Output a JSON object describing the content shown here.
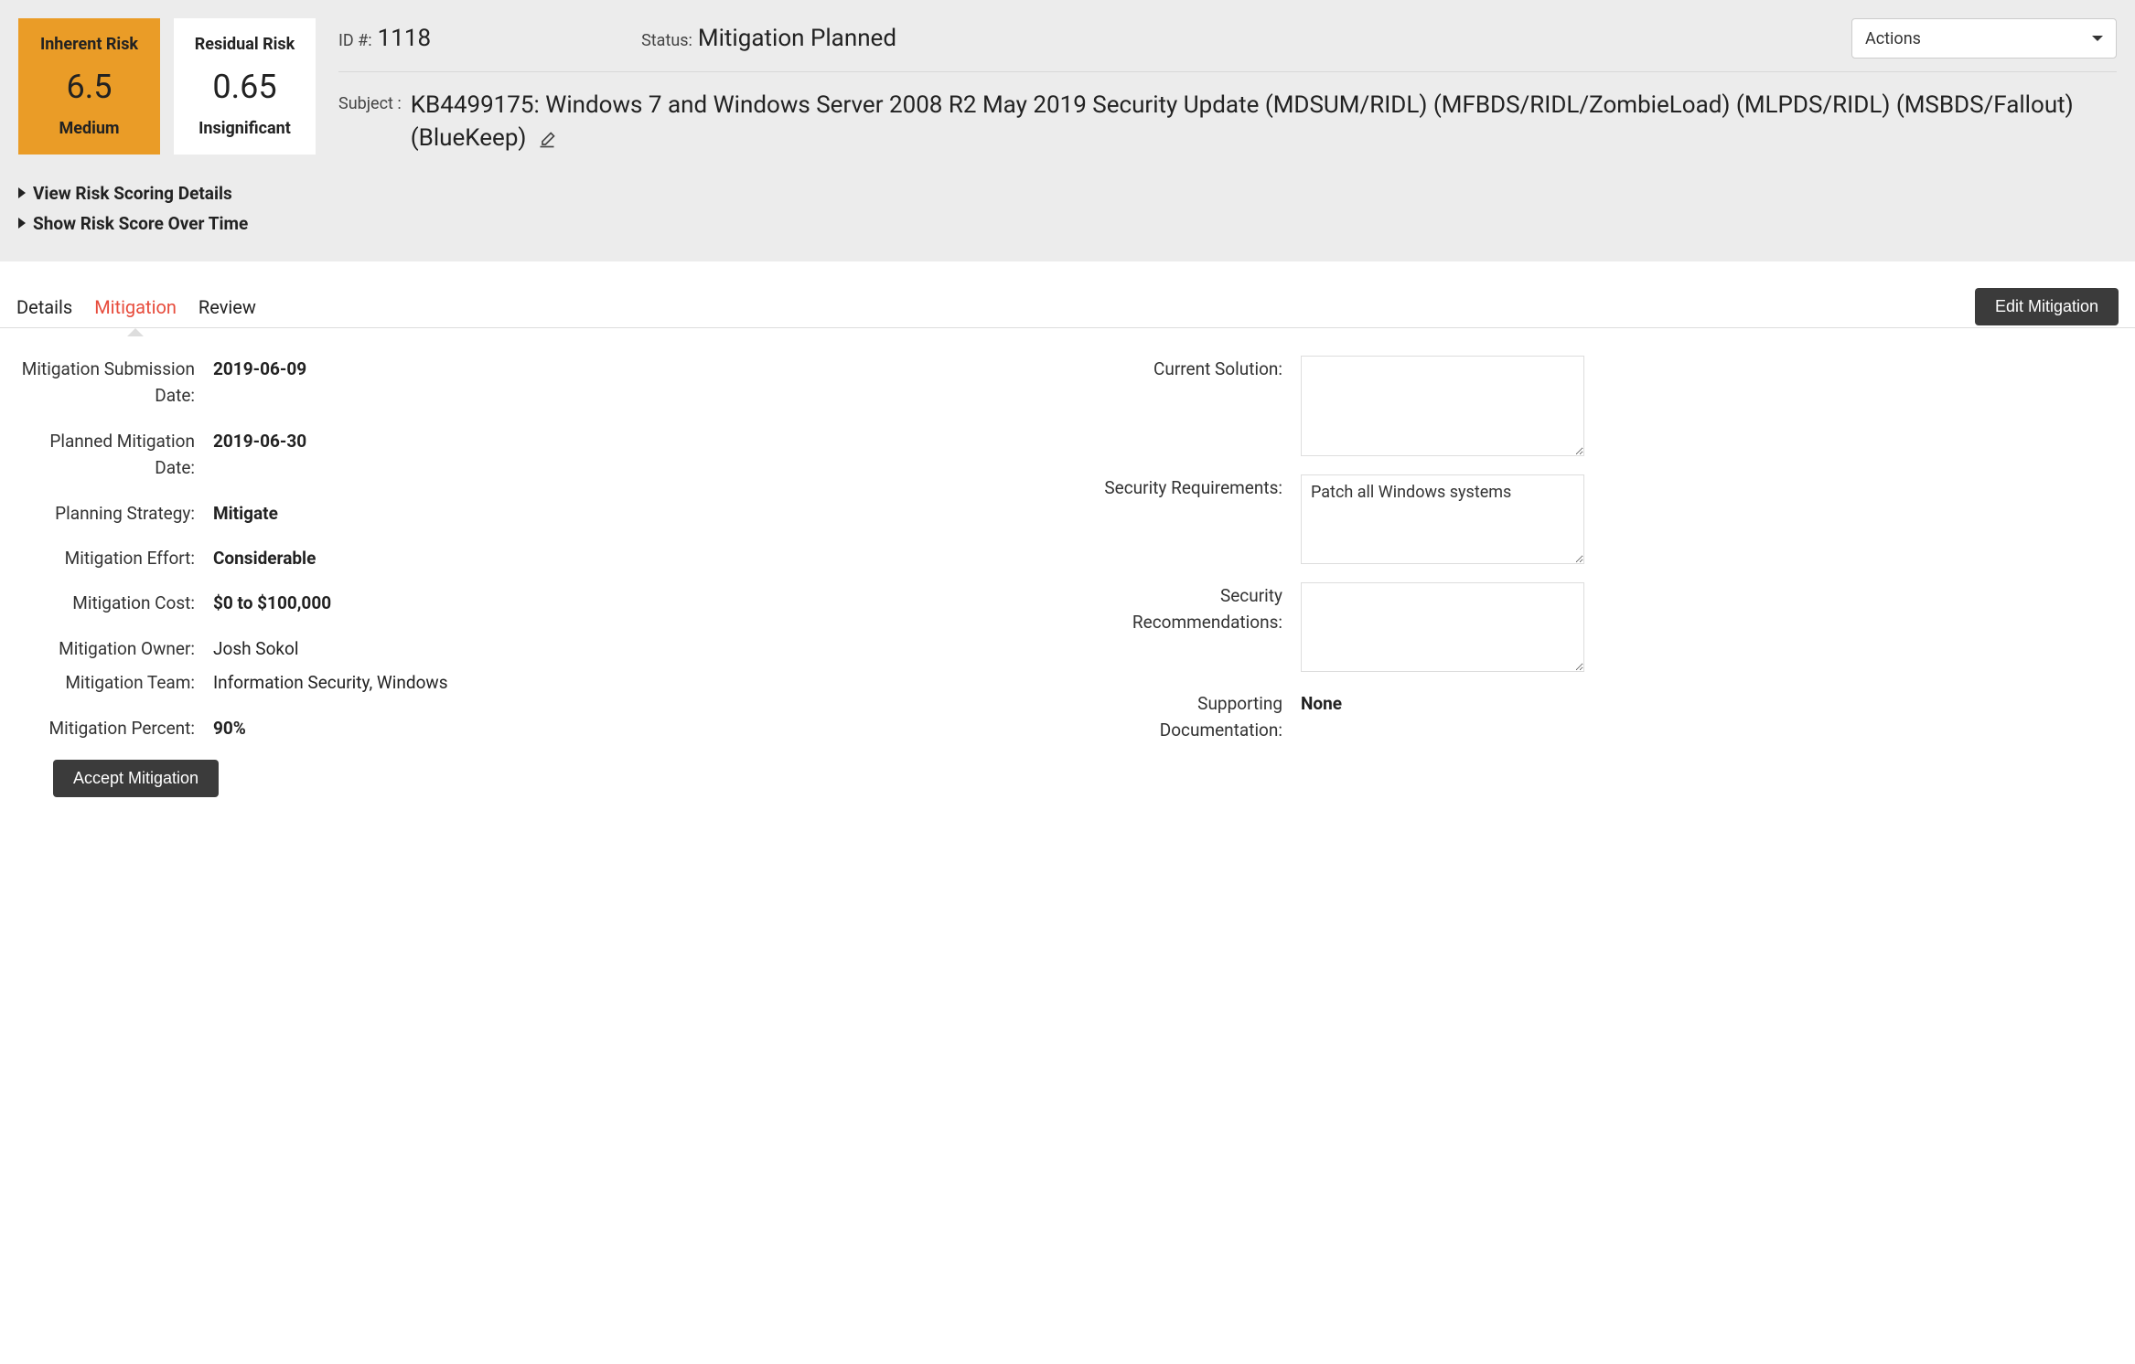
{
  "risk": {
    "inherent": {
      "title": "Inherent Risk",
      "score": "6.5",
      "level": "Medium"
    },
    "residual": {
      "title": "Residual Risk",
      "score": "0.65",
      "level": "Insignificant"
    }
  },
  "meta": {
    "id_label": "ID #:",
    "id_value": "1118",
    "status_label": "Status:",
    "status_value": "Mitigation Planned",
    "actions_label": "Actions",
    "subject_label": "Subject :",
    "subject_value": "KB4499175: Windows 7 and Windows Server 2008 R2 May 2019 Security Update (MDSUM/RIDL) (MFBDS/RIDL/ZombieLoad) (MLPDS/RIDL) (MSBDS/Fallout) (BlueKeep)"
  },
  "toggles": {
    "scoring_details": "View Risk Scoring Details",
    "score_over_time": "Show Risk Score Over Time"
  },
  "tabs": {
    "details": "Details",
    "mitigation": "Mitigation",
    "review": "Review"
  },
  "buttons": {
    "edit_mitigation": "Edit Mitigation",
    "accept_mitigation": "Accept Mitigation"
  },
  "left": {
    "submission_date_label": "Mitigation Submission Date:",
    "submission_date": "2019-06-09",
    "planned_date_label": "Planned Mitigation Date:",
    "planned_date": "2019-06-30",
    "strategy_label": "Planning Strategy:",
    "strategy": "Mitigate",
    "effort_label": "Mitigation Effort:",
    "effort": "Considerable",
    "cost_label": "Mitigation Cost:",
    "cost": "$0 to $100,000",
    "owner_label": "Mitigation Owner:",
    "owner": "Josh Sokol",
    "team_label": "Mitigation Team:",
    "team": "Information Security, Windows",
    "percent_label": "Mitigation Percent:",
    "percent": "90%"
  },
  "right": {
    "current_solution_label": "Current Solution:",
    "current_solution": "",
    "sec_req_label": "Security Requirements:",
    "sec_req": "Patch all Windows systems",
    "sec_rec_label": "Security Recommendations:",
    "sec_rec": "",
    "sup_doc_label": "Supporting Documentation:",
    "sup_doc": "None"
  }
}
